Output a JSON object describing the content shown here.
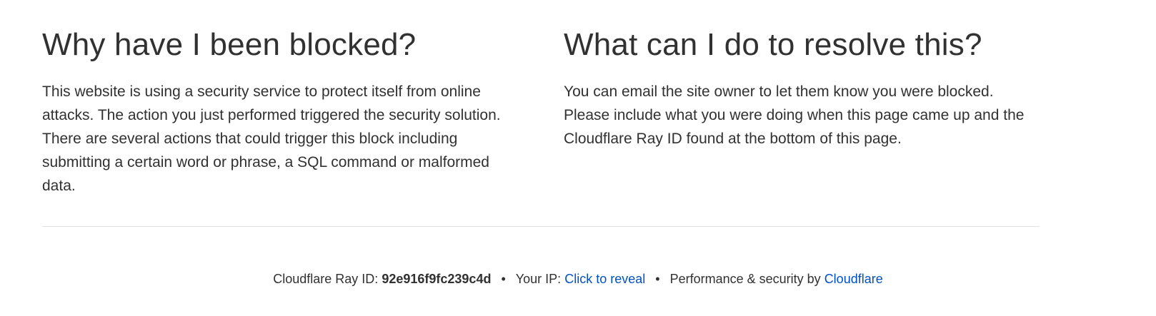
{
  "left_section": {
    "heading": "Why have I been blocked?",
    "body": "This website is using a security service to protect itself from online attacks. The action you just performed triggered the security solution. There are several actions that could trigger this block including submitting a certain word or phrase, a SQL command or malformed data."
  },
  "right_section": {
    "heading": "What can I do to resolve this?",
    "body": "You can email the site owner to let them know you were blocked. Please include what you were doing when this page came up and the Cloudflare Ray ID found at the bottom of this page."
  },
  "footer": {
    "ray_label": "Cloudflare Ray ID:",
    "ray_id": "92e916f9fc239c4d",
    "separator": "•",
    "ip_label": "Your IP:",
    "ip_link": "Click to reveal",
    "perf_label": "Performance & security by",
    "cloudflare_link": "Cloudflare"
  },
  "colors": {
    "text": "#313131",
    "link": "#0051c3",
    "divider": "#e2e2e2",
    "background": "#ffffff"
  }
}
